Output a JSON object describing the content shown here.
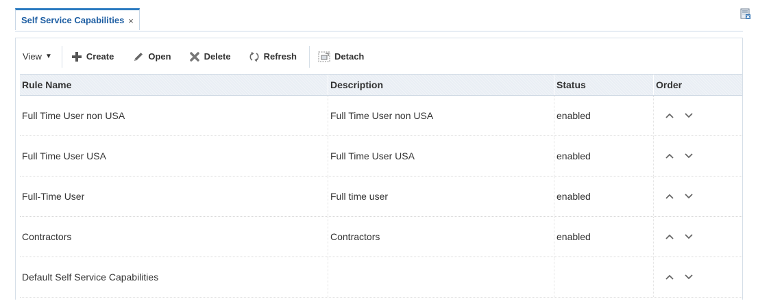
{
  "tab": {
    "label": "Self Service Capabilities",
    "close": "×"
  },
  "toolbar": {
    "view_label": "View",
    "create_label": "Create",
    "open_label": "Open",
    "delete_label": "Delete",
    "refresh_label": "Refresh",
    "detach_label": "Detach"
  },
  "table": {
    "headers": {
      "rule_name": "Rule Name",
      "description": "Description",
      "status": "Status",
      "order": "Order"
    },
    "rows": [
      {
        "rule_name": "Full Time User non USA",
        "description": "Full Time User non USA",
        "status": "enabled"
      },
      {
        "rule_name": "Full Time User USA",
        "description": "Full Time User USA",
        "status": "enabled"
      },
      {
        "rule_name": "Full-Time User",
        "description": "Full time user",
        "status": "enabled"
      },
      {
        "rule_name": "Contractors",
        "description": "Contractors",
        "status": "enabled"
      },
      {
        "rule_name": "Default Self Service Capabilities",
        "description": "",
        "status": ""
      }
    ]
  },
  "colors": {
    "tab_accent": "#2a7ac0",
    "tab_text": "#1f5fa3",
    "header_bg": "#e9eef4",
    "create_icon": "#555555",
    "delete_icon": "#777777"
  },
  "icons": {
    "help": "help-window-icon",
    "create": "plus-icon",
    "open": "pencil-icon",
    "delete": "x-icon",
    "refresh": "refresh-icon",
    "detach": "detach-icon",
    "move_up": "chevron-up-icon",
    "move_down": "chevron-down-icon"
  }
}
